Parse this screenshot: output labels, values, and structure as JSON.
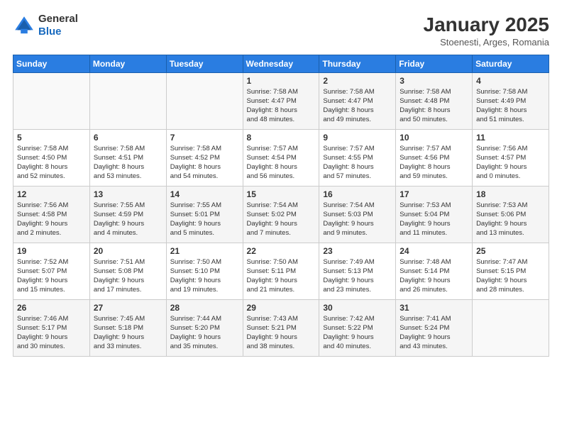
{
  "header": {
    "logo_line1": "General",
    "logo_line2": "Blue",
    "month_title": "January 2025",
    "subtitle": "Stoenesti, Arges, Romania"
  },
  "weekdays": [
    "Sunday",
    "Monday",
    "Tuesday",
    "Wednesday",
    "Thursday",
    "Friday",
    "Saturday"
  ],
  "weeks": [
    [
      {
        "day": "",
        "info": ""
      },
      {
        "day": "",
        "info": ""
      },
      {
        "day": "",
        "info": ""
      },
      {
        "day": "1",
        "info": "Sunrise: 7:58 AM\nSunset: 4:47 PM\nDaylight: 8 hours\nand 48 minutes."
      },
      {
        "day": "2",
        "info": "Sunrise: 7:58 AM\nSunset: 4:47 PM\nDaylight: 8 hours\nand 49 minutes."
      },
      {
        "day": "3",
        "info": "Sunrise: 7:58 AM\nSunset: 4:48 PM\nDaylight: 8 hours\nand 50 minutes."
      },
      {
        "day": "4",
        "info": "Sunrise: 7:58 AM\nSunset: 4:49 PM\nDaylight: 8 hours\nand 51 minutes."
      }
    ],
    [
      {
        "day": "5",
        "info": "Sunrise: 7:58 AM\nSunset: 4:50 PM\nDaylight: 8 hours\nand 52 minutes."
      },
      {
        "day": "6",
        "info": "Sunrise: 7:58 AM\nSunset: 4:51 PM\nDaylight: 8 hours\nand 53 minutes."
      },
      {
        "day": "7",
        "info": "Sunrise: 7:58 AM\nSunset: 4:52 PM\nDaylight: 8 hours\nand 54 minutes."
      },
      {
        "day": "8",
        "info": "Sunrise: 7:57 AM\nSunset: 4:54 PM\nDaylight: 8 hours\nand 56 minutes."
      },
      {
        "day": "9",
        "info": "Sunrise: 7:57 AM\nSunset: 4:55 PM\nDaylight: 8 hours\nand 57 minutes."
      },
      {
        "day": "10",
        "info": "Sunrise: 7:57 AM\nSunset: 4:56 PM\nDaylight: 8 hours\nand 59 minutes."
      },
      {
        "day": "11",
        "info": "Sunrise: 7:56 AM\nSunset: 4:57 PM\nDaylight: 9 hours\nand 0 minutes."
      }
    ],
    [
      {
        "day": "12",
        "info": "Sunrise: 7:56 AM\nSunset: 4:58 PM\nDaylight: 9 hours\nand 2 minutes."
      },
      {
        "day": "13",
        "info": "Sunrise: 7:55 AM\nSunset: 4:59 PM\nDaylight: 9 hours\nand 4 minutes."
      },
      {
        "day": "14",
        "info": "Sunrise: 7:55 AM\nSunset: 5:01 PM\nDaylight: 9 hours\nand 5 minutes."
      },
      {
        "day": "15",
        "info": "Sunrise: 7:54 AM\nSunset: 5:02 PM\nDaylight: 9 hours\nand 7 minutes."
      },
      {
        "day": "16",
        "info": "Sunrise: 7:54 AM\nSunset: 5:03 PM\nDaylight: 9 hours\nand 9 minutes."
      },
      {
        "day": "17",
        "info": "Sunrise: 7:53 AM\nSunset: 5:04 PM\nDaylight: 9 hours\nand 11 minutes."
      },
      {
        "day": "18",
        "info": "Sunrise: 7:53 AM\nSunset: 5:06 PM\nDaylight: 9 hours\nand 13 minutes."
      }
    ],
    [
      {
        "day": "19",
        "info": "Sunrise: 7:52 AM\nSunset: 5:07 PM\nDaylight: 9 hours\nand 15 minutes."
      },
      {
        "day": "20",
        "info": "Sunrise: 7:51 AM\nSunset: 5:08 PM\nDaylight: 9 hours\nand 17 minutes."
      },
      {
        "day": "21",
        "info": "Sunrise: 7:50 AM\nSunset: 5:10 PM\nDaylight: 9 hours\nand 19 minutes."
      },
      {
        "day": "22",
        "info": "Sunrise: 7:50 AM\nSunset: 5:11 PM\nDaylight: 9 hours\nand 21 minutes."
      },
      {
        "day": "23",
        "info": "Sunrise: 7:49 AM\nSunset: 5:13 PM\nDaylight: 9 hours\nand 23 minutes."
      },
      {
        "day": "24",
        "info": "Sunrise: 7:48 AM\nSunset: 5:14 PM\nDaylight: 9 hours\nand 26 minutes."
      },
      {
        "day": "25",
        "info": "Sunrise: 7:47 AM\nSunset: 5:15 PM\nDaylight: 9 hours\nand 28 minutes."
      }
    ],
    [
      {
        "day": "26",
        "info": "Sunrise: 7:46 AM\nSunset: 5:17 PM\nDaylight: 9 hours\nand 30 minutes."
      },
      {
        "day": "27",
        "info": "Sunrise: 7:45 AM\nSunset: 5:18 PM\nDaylight: 9 hours\nand 33 minutes."
      },
      {
        "day": "28",
        "info": "Sunrise: 7:44 AM\nSunset: 5:20 PM\nDaylight: 9 hours\nand 35 minutes."
      },
      {
        "day": "29",
        "info": "Sunrise: 7:43 AM\nSunset: 5:21 PM\nDaylight: 9 hours\nand 38 minutes."
      },
      {
        "day": "30",
        "info": "Sunrise: 7:42 AM\nSunset: 5:22 PM\nDaylight: 9 hours\nand 40 minutes."
      },
      {
        "day": "31",
        "info": "Sunrise: 7:41 AM\nSunset: 5:24 PM\nDaylight: 9 hours\nand 43 minutes."
      },
      {
        "day": "",
        "info": ""
      }
    ]
  ]
}
